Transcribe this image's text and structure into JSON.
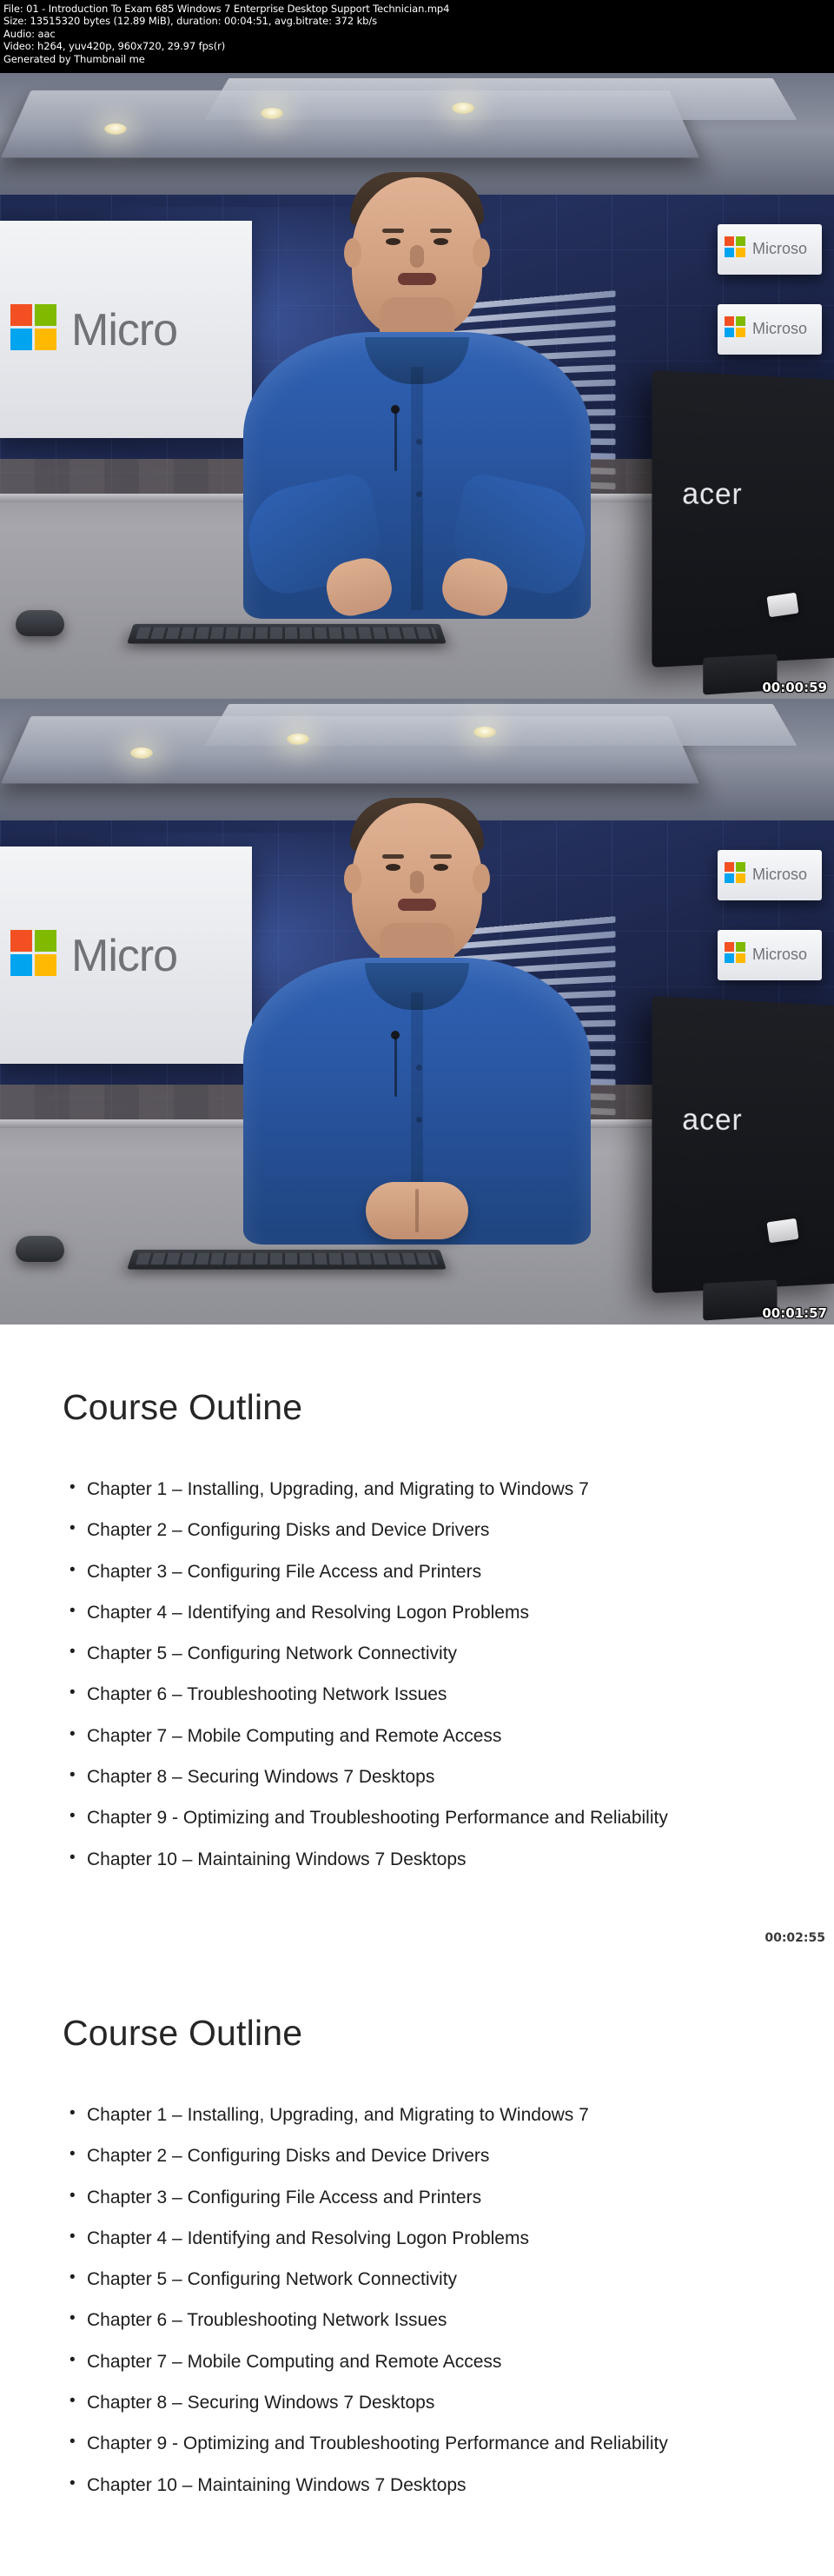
{
  "header": {
    "file_line": "File: 01 - Introduction To Exam 685 Windows 7 Enterprise Desktop Support Technician.mp4",
    "size_line": "Size: 13515320 bytes (12.89 MiB), duration: 00:04:51, avg.bitrate: 372 kb/s",
    "audio_line": "Audio: aac",
    "video_line": "Video: h264, yuv420p, 960x720, 29.97 fps(r)",
    "generated_line": "Generated by Thumbnail me"
  },
  "frames": [
    {
      "id": "frame-1",
      "timestamp": "00:00:59",
      "type": "video",
      "monitor_brand": "acer",
      "wall_logo_text": "Micro",
      "screen_labels": [
        "Microso",
        "Microso"
      ]
    },
    {
      "id": "frame-2",
      "timestamp": "00:01:57",
      "type": "video",
      "monitor_brand": "acer",
      "wall_logo_text": "Micro",
      "screen_labels": [
        "Microso",
        "Microso"
      ]
    },
    {
      "id": "frame-3",
      "timestamp": "00:02:55",
      "type": "slide"
    },
    {
      "id": "frame-4",
      "timestamp": "",
      "type": "slide"
    }
  ],
  "slide": {
    "title": "Course Outline",
    "bullets": [
      "Chapter 1 – Installing, Upgrading, and Migrating to Windows 7",
      "Chapter 2 – Configuring Disks and Device Drivers",
      "Chapter 3 – Configuring File Access and Printers",
      "Chapter 4 – Identifying and Resolving Logon Problems",
      "Chapter 5 – Configuring Network Connectivity",
      "Chapter 6 – Troubleshooting Network Issues",
      "Chapter 7 – Mobile Computing and Remote Access",
      "Chapter 8 – Securing Windows 7 Desktops",
      "Chapter 9 - Optimizing and Troubleshooting Performance and Reliability",
      "Chapter 10 – Maintaining Windows 7 Desktops"
    ]
  },
  "colors": {
    "ms_red": "#f25022",
    "ms_green": "#7fba00",
    "ms_blue": "#00a4ef",
    "ms_yellow": "#ffb900",
    "shirt_blue": "#2f62b5",
    "background": "#000000",
    "slide_bg": "#ffffff"
  }
}
